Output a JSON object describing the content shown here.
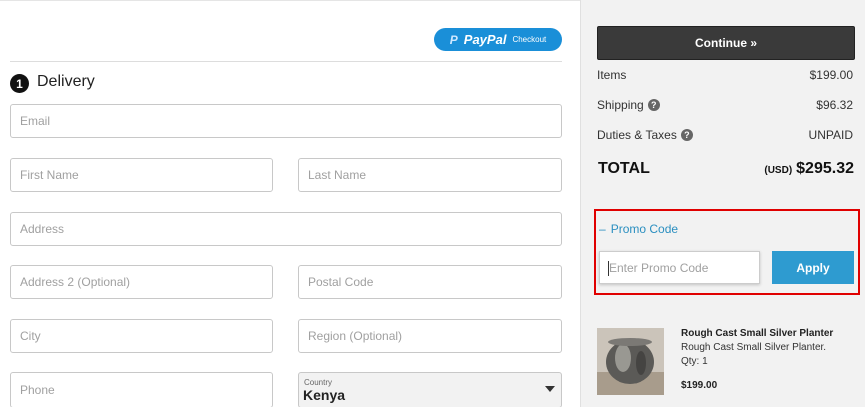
{
  "paypal": {
    "brand": "PayPal",
    "checkout_label": "Checkout"
  },
  "delivery": {
    "step_number": "1",
    "title": "Delivery",
    "fields": {
      "email": "Email",
      "first_name": "First Name",
      "last_name": "Last Name",
      "address": "Address",
      "address2": "Address 2 (Optional)",
      "postal_code": "Postal Code",
      "city": "City",
      "region": "Region (Optional)",
      "phone": "Phone"
    },
    "country": {
      "label": "Country",
      "value": "Kenya"
    }
  },
  "summary": {
    "continue_label": "Continue »",
    "items_label": "Items",
    "items_value": "$199.00",
    "shipping_label": "Shipping",
    "shipping_value": "$96.32",
    "duties_label": "Duties & Taxes",
    "duties_value": "UNPAID",
    "total_label": "TOTAL",
    "total_currency": "(USD)",
    "total_value": "$295.32",
    "help_glyph": "?"
  },
  "promo": {
    "toggle_symbol": "–",
    "toggle_label": "Promo Code",
    "placeholder": "Enter Promo Code",
    "apply_label": "Apply"
  },
  "product": {
    "title": "Rough Cast Small Silver Planter",
    "subtitle": "Rough Cast Small Silver Planter.",
    "qty": "Qty: 1",
    "price": "$199.00"
  },
  "colors": {
    "accent": "#2e9bd0",
    "paypal": "#1a8fd8",
    "highlight": "#e00000",
    "continue_bg": "#3a3a3a"
  }
}
